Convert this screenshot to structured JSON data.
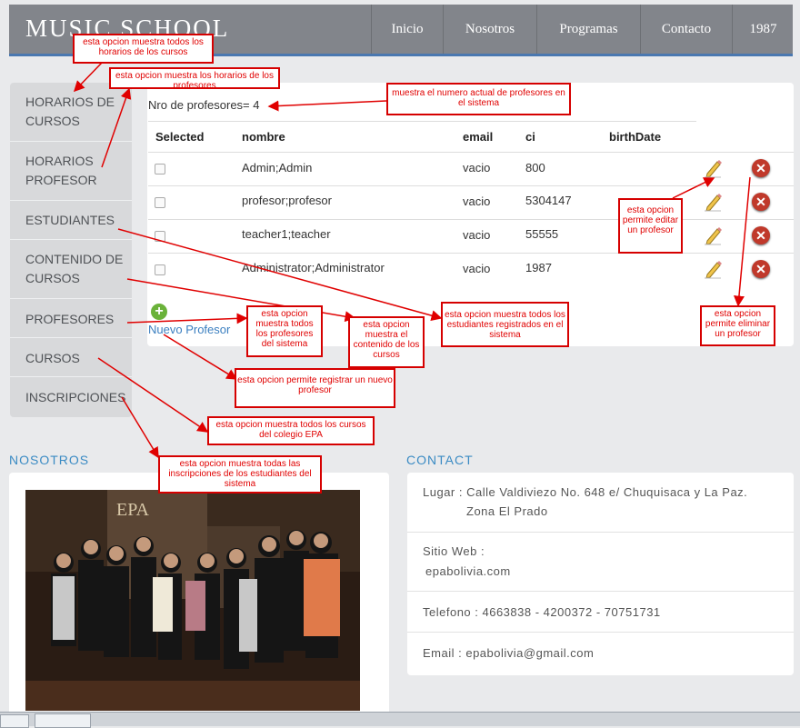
{
  "brand": "MUSIC SCHOOL",
  "nav": [
    "Inicio",
    "Nosotros",
    "Programas",
    "Contacto",
    "1987"
  ],
  "sidebar": [
    "HORARIOS DE CURSOS",
    "HORARIOS PROFESOR",
    "ESTUDIANTES",
    "CONTENIDO DE CURSOS",
    "PROFESORES",
    "CURSOS",
    "INSCRIPCIONES"
  ],
  "professors": {
    "count_text": "Nro de profesores= 4",
    "headers": [
      "Selected",
      "nombre",
      "email",
      "ci",
      "birthDate"
    ],
    "rows": [
      {
        "nombre": "Admin;Admin",
        "email": "vacio",
        "ci": "800",
        "birthDate": ""
      },
      {
        "nombre": "profesor;profesor",
        "email": "vacio",
        "ci": "5304147",
        "birthDate": ""
      },
      {
        "nombre": "teacher1;teacher",
        "email": "vacio",
        "ci": "55555",
        "birthDate": ""
      },
      {
        "nombre": "Administrator;Administrator",
        "email": "vacio",
        "ci": "1987",
        "birthDate": ""
      }
    ],
    "new_label": "Nuevo Profesor"
  },
  "about": {
    "title": "NOSOTROS",
    "photo_logo": "EPA"
  },
  "contact": {
    "title": "CONTACT",
    "lugar_line1": "Lugar : Calle Valdiviezo No. 648 e/ Chuquisaca y La Paz.",
    "lugar_line2": "Zona El Prado",
    "web_label": "Sitio Web :",
    "web_value": "epabolivia.com",
    "telefono": "Telefono : 4663838 - 4200372 - 70751731",
    "email": "Email : epabolivia@gmail.com"
  },
  "annotations": {
    "a1": "esta opcion muestra todos los horarios de los cursos",
    "a2": "esta opcion muestra los horarios de los profesores",
    "a3": "muestra el numero actual de profesores en el sistema",
    "a4": "esta opcion permite editar un profesor",
    "a5": "esta opcion permite eliminar un profesor",
    "a6": "esta opcion muestra todos los profesores del sistema",
    "a7": "esta opcion muestra el contenido de los cursos",
    "a8": "esta opcion muestra todos los estudiantes registrados en el sistema",
    "a9": "esta opcion permite registrar un nuevo profesor",
    "a10": "esta opcion muestra todos los cursos del colegio EPA",
    "a11": "esta opcion muestra todas las inscripciones de los estudiantes del sistema"
  },
  "colors": {
    "accent": "#3b8bc4",
    "annotation": "#e00000",
    "header": "#82858b"
  }
}
